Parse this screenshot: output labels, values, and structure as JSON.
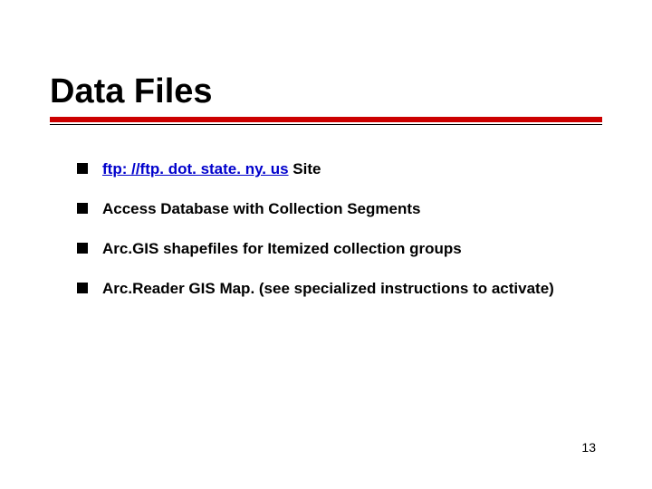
{
  "title": "Data Files",
  "bullets": [
    {
      "link": "ftp: //ftp. dot. state. ny. us",
      "suffix": "  Site"
    },
    {
      "text": "Access Database with Collection Segments"
    },
    {
      "text": "Arc.GIS shapefiles for Itemized collection groups"
    },
    {
      "text": "Arc.Reader GIS Map.  (see specialized instructions to activate)"
    }
  ],
  "page_number": "13"
}
